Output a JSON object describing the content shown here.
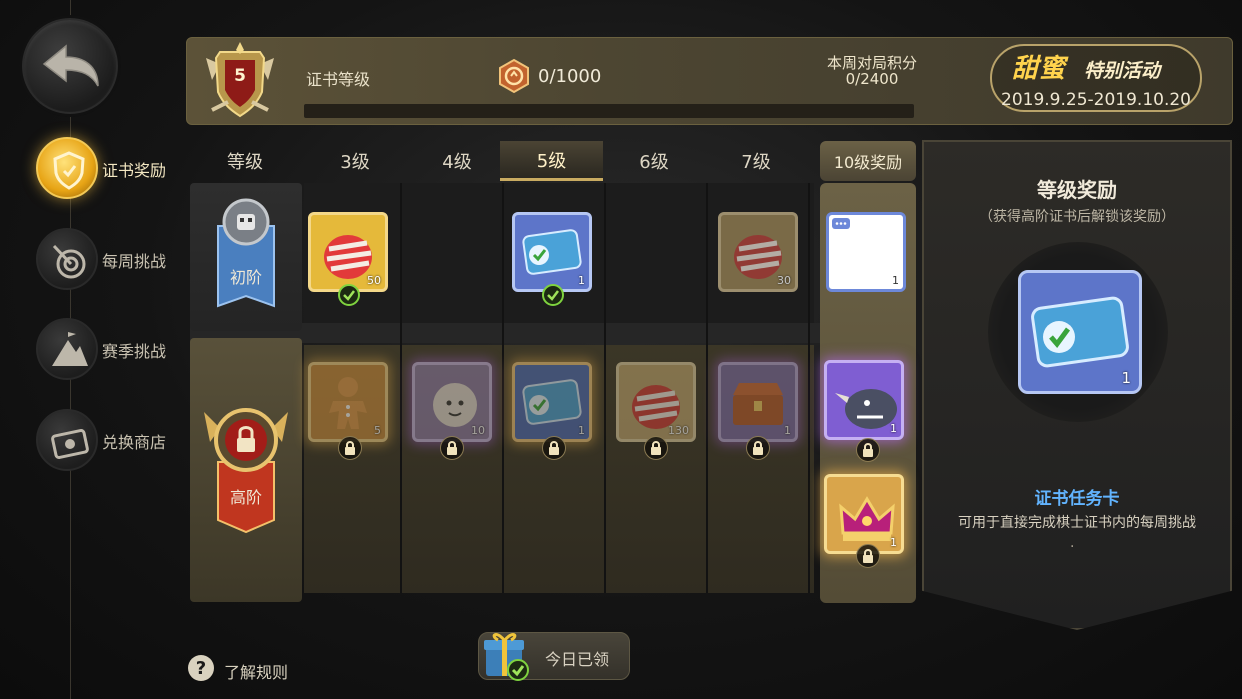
{
  "header": {
    "level_number": "5",
    "cert_level_label": "证书等级",
    "xp_progress": "0/1000",
    "weekly_points_label": "本周对局积分",
    "weekly_points_value": "0/2400",
    "event_title": "甜蜜",
    "event_subtitle": "特别活动",
    "event_dates": "2019.9.25-2019.10.20"
  },
  "sidebar": {
    "items": [
      {
        "label": "证书奖励",
        "icon": "shield-crest-icon",
        "active": true
      },
      {
        "label": "每周挑战",
        "icon": "target-icon",
        "active": false
      },
      {
        "label": "赛季挑战",
        "icon": "mountain-flag-icon",
        "active": false
      },
      {
        "label": "兑换商店",
        "icon": "ticket-icon",
        "active": false
      }
    ]
  },
  "grid": {
    "level_header": "等级",
    "columns": [
      "3级",
      "4级",
      "5级",
      "6级",
      "7级"
    ],
    "current_column": "5级",
    "bonus_header": "10级奖励",
    "tiers": {
      "basic": {
        "label": "初阶",
        "rewards": [
          {
            "level": "3级",
            "item": "candy-egg",
            "qty": "50",
            "claimed": true
          },
          {
            "level": "4级",
            "item": null
          },
          {
            "level": "5级",
            "item": "task-card",
            "qty": "1",
            "claimed": true
          },
          {
            "level": "6级",
            "item": null
          },
          {
            "level": "7级",
            "item": "candy-egg",
            "qty": "30",
            "claimed": false
          }
        ],
        "bonus": {
          "item": "emote-card",
          "qty": "1"
        }
      },
      "advanced": {
        "label": "高阶",
        "rewards": [
          {
            "level": "3级",
            "item": "gingerbread",
            "qty": "5",
            "locked": true
          },
          {
            "level": "4级",
            "item": "avatar-frame",
            "qty": "10",
            "locked": true
          },
          {
            "level": "5级",
            "item": "task-card",
            "qty": "1",
            "locked": true
          },
          {
            "level": "6级",
            "item": "candy-egg",
            "qty": "130",
            "locked": true
          },
          {
            "level": "7级",
            "item": "treasure-chest",
            "qty": "1",
            "locked": true
          }
        ],
        "bonus": [
          {
            "item": "rhino-hero",
            "qty": "1",
            "locked": true
          },
          {
            "item": "crown",
            "qty": "1",
            "locked": true
          }
        ]
      }
    }
  },
  "detail_panel": {
    "title": "等级奖励",
    "subtitle": "（获得高阶证书后解锁该奖励）",
    "item_qty": "1",
    "item_name": "证书任务卡",
    "item_desc": "可用于直接完成棋士证书内的每周挑战",
    "dot": "."
  },
  "footer": {
    "help_symbol": "?",
    "help_label": "了解规则",
    "daily_label": "今日已领"
  },
  "colors": {
    "gold": "#e7a415",
    "item_name_blue": "#62b4ff",
    "claim_green": "#7fd33f",
    "event_yellow": "#ffd34d"
  }
}
